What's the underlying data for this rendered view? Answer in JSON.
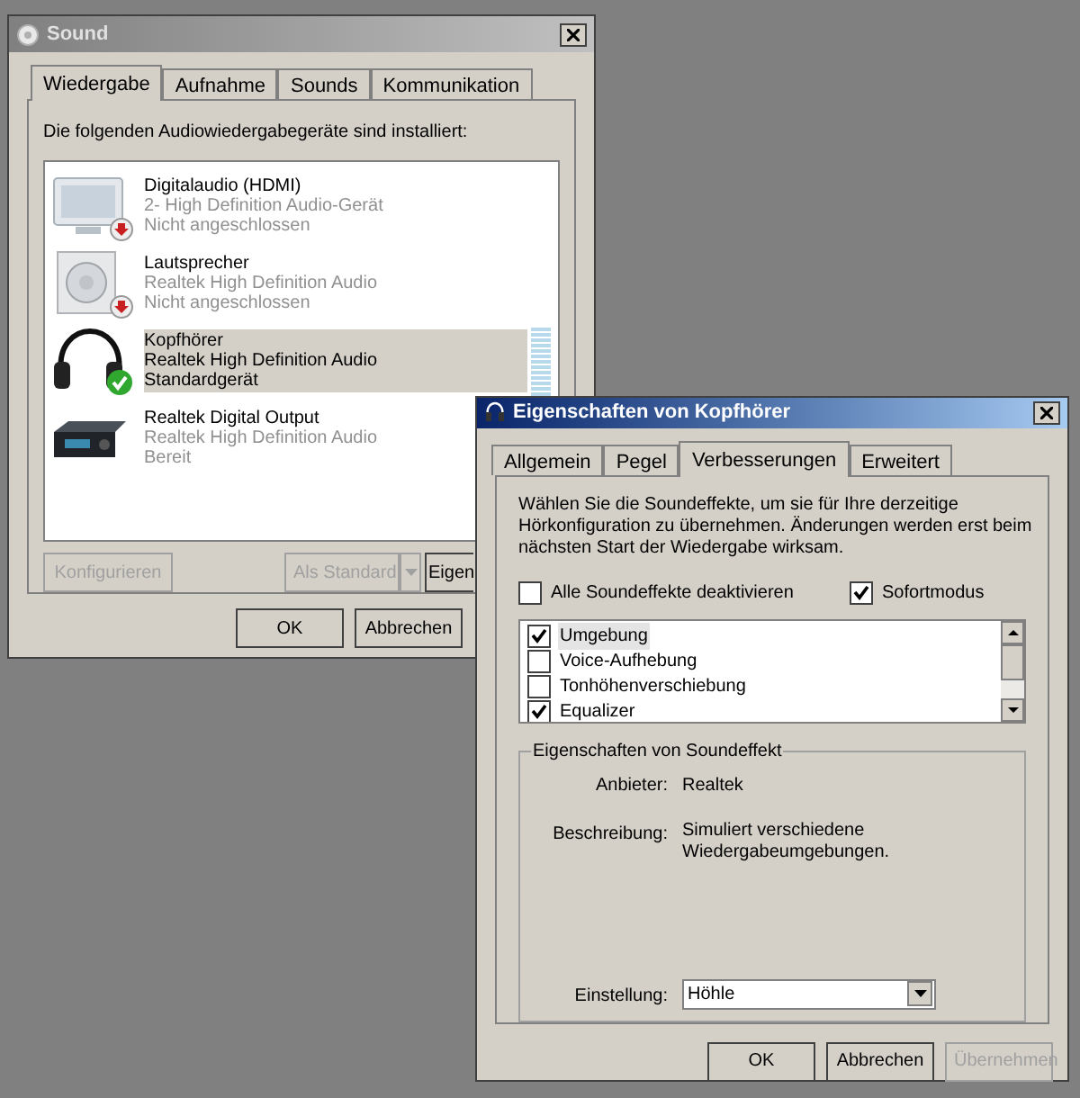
{
  "sound_window": {
    "title": "Sound",
    "tabs": [
      {
        "label": "Wiedergabe",
        "selected": true
      },
      {
        "label": "Aufnahme",
        "selected": false
      },
      {
        "label": "Sounds",
        "selected": false
      },
      {
        "label": "Kommunikation",
        "selected": false
      }
    ],
    "intro": "Die folgenden Audiowiedergabegeräte sind installiert:",
    "devices": [
      {
        "kind": "monitor",
        "name": "Digitalaudio (HDMI)",
        "driver": "2- High Definition Audio-Gerät",
        "status": "Nicht angeschlossen",
        "connected": false,
        "is_default": false,
        "selected": false
      },
      {
        "kind": "speaker",
        "name": "Lautsprecher",
        "driver": "Realtek High Definition Audio",
        "status": "Nicht angeschlossen",
        "connected": false,
        "is_default": false,
        "selected": false
      },
      {
        "kind": "headphones",
        "name": "Kopfhörer",
        "driver": "Realtek High Definition Audio",
        "status": "Standardgerät",
        "connected": true,
        "is_default": true,
        "selected": true
      },
      {
        "kind": "receiver",
        "name": "Realtek Digital Output",
        "driver": "Realtek High Definition Audio",
        "status": "Bereit",
        "connected": true,
        "is_default": false,
        "selected": false
      }
    ],
    "configure_button": {
      "label": "Konfigurieren",
      "disabled": true
    },
    "default_button": {
      "label": "Als Standard",
      "disabled": true
    },
    "properties_button": {
      "label": "Eigen",
      "disabled": false
    },
    "buttons": [
      {
        "label": "OK",
        "disabled": false
      },
      {
        "label": "Abbrechen",
        "disabled": false
      }
    ]
  },
  "properties_window": {
    "title": "Eigenschaften von Kopfhörer",
    "tabs": [
      {
        "label": "Allgemein",
        "selected": false
      },
      {
        "label": "Pegel",
        "selected": false
      },
      {
        "label": "Verbesserungen",
        "selected": true
      },
      {
        "label": "Erweitert",
        "selected": false
      }
    ],
    "intro": "Wählen Sie die Soundeffekte, um sie für Ihre derzeitige Hörkonfiguration zu übernehmen. Änderungen werden erst beim nächsten Start der Wiedergabe wirksam.",
    "disable_all": {
      "label": "Alle Soundeffekte deaktivieren",
      "checked": false
    },
    "immediate_mode": {
      "label": "Sofortmodus",
      "checked": true
    },
    "effects": [
      {
        "label": "Umgebung",
        "checked": true,
        "selected": true
      },
      {
        "label": "Voice-Aufhebung",
        "checked": false,
        "selected": false
      },
      {
        "label": "Tonhöhenverschiebung",
        "checked": false,
        "selected": false
      },
      {
        "label": "Equalizer",
        "checked": true,
        "selected": false
      }
    ],
    "effect_properties": {
      "title": "Eigenschaften von Soundeffekt",
      "provider_label": "Anbieter:",
      "provider": "Realtek",
      "description_label": "Beschreibung:",
      "description": "Simuliert verschiedene Wiedergabeumgebungen.",
      "setting_label": "Einstellung:",
      "setting": "Höhle"
    },
    "buttons": [
      {
        "label": "OK",
        "disabled": false
      },
      {
        "label": "Abbrechen",
        "disabled": false
      },
      {
        "label": "Übernehmen",
        "disabled": true
      }
    ]
  }
}
